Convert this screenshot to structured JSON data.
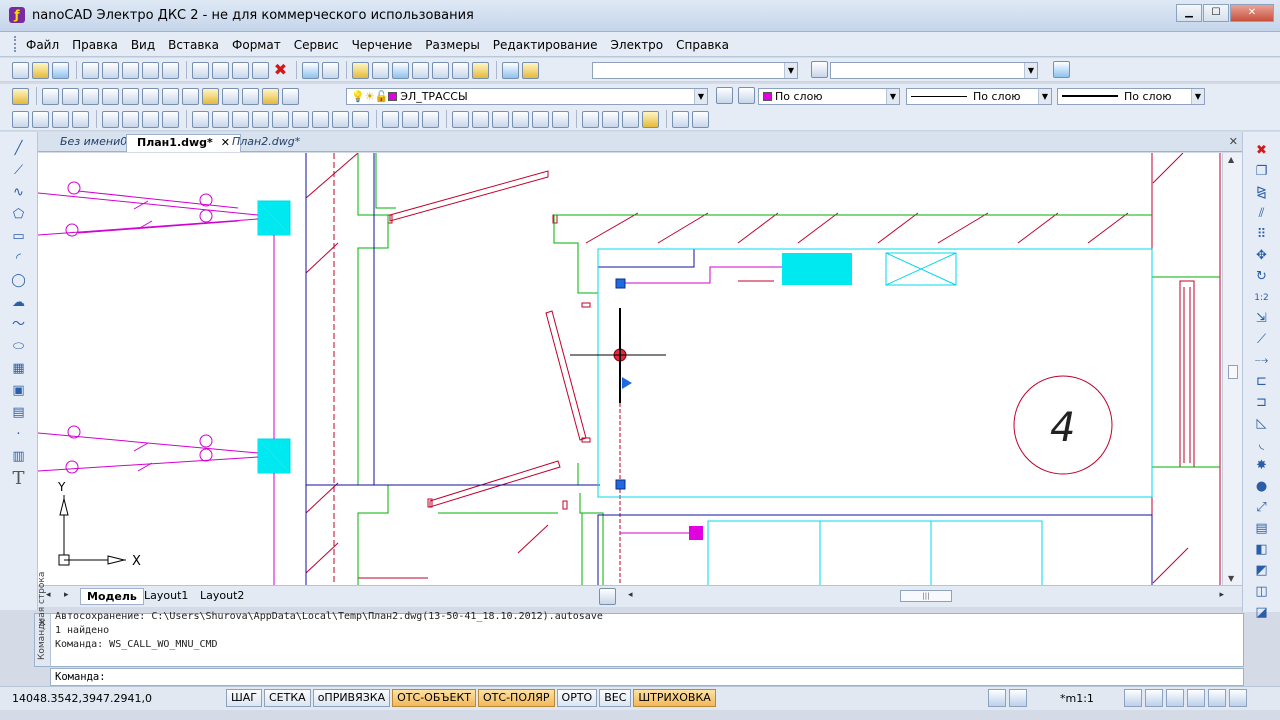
{
  "window": {
    "title": "nanoCAD Электро ДКС 2 - не для коммерческого использования",
    "app_icon_glyph": "ƒ",
    "buttons": {
      "minimize": "▁",
      "maximize": "☐",
      "close": "✕"
    }
  },
  "menu": [
    "Файл",
    "Правка",
    "Вид",
    "Вставка",
    "Формат",
    "Сервис",
    "Черчение",
    "Размеры",
    "Редактирование",
    "Электро",
    "Справка"
  ],
  "properties_bar": {
    "layer": "ЭЛ_ТРАССЫ",
    "color": "По слою",
    "color_hex": "#e000e0",
    "linetype": "По слою",
    "lineweight": "По слою"
  },
  "document_tabs": [
    {
      "label": "Без имени0",
      "active": false
    },
    {
      "label": "План1.dwg*",
      "active": true
    },
    {
      "label": "План2.dwg*",
      "active": false
    }
  ],
  "doc_tab_close": "✕",
  "drawing": {
    "room_number": "4",
    "ucs": {
      "y_label": "Y",
      "x_label": "X"
    }
  },
  "layout_tabs": [
    "Модель",
    "Layout1",
    "Layout2"
  ],
  "layout_nav": {
    "prev": "◂",
    "next": "▸"
  },
  "command_history": [
    "Автосохранение: C:\\Users\\Shurova\\AppData\\Local\\Temp\\План2.dwg(13-50-41_18.10.2012).autosave",
    "1 найдено",
    "Команда: WS_CALL_WO_MNU_CMD"
  ],
  "command_side_label": "Командная строка",
  "command_prompt": "Команда:",
  "status_bar": {
    "coordinates": "14048.3542,3947.2941,0",
    "toggles": [
      {
        "label": "ШАГ",
        "on": false
      },
      {
        "label": "СЕТКА",
        "on": false
      },
      {
        "label": "оПРИВЯЗКА",
        "on": false
      },
      {
        "label": "ОТС-ОБЪЕКТ",
        "on": true
      },
      {
        "label": "ОТС-ПОЛЯР",
        "on": true
      },
      {
        "label": "ОРТО",
        "on": false
      },
      {
        "label": "ВЕС",
        "on": false
      },
      {
        "label": "ШТРИХОВКА",
        "on": true
      }
    ],
    "scale": "*m1:1"
  },
  "colors": {
    "walls_red": "#c0002a",
    "walls_green": "#00b000",
    "cable_magenta": "#d000d0",
    "equipment_cyan": "#00e8f0",
    "outline_blue": "#1010a0"
  }
}
